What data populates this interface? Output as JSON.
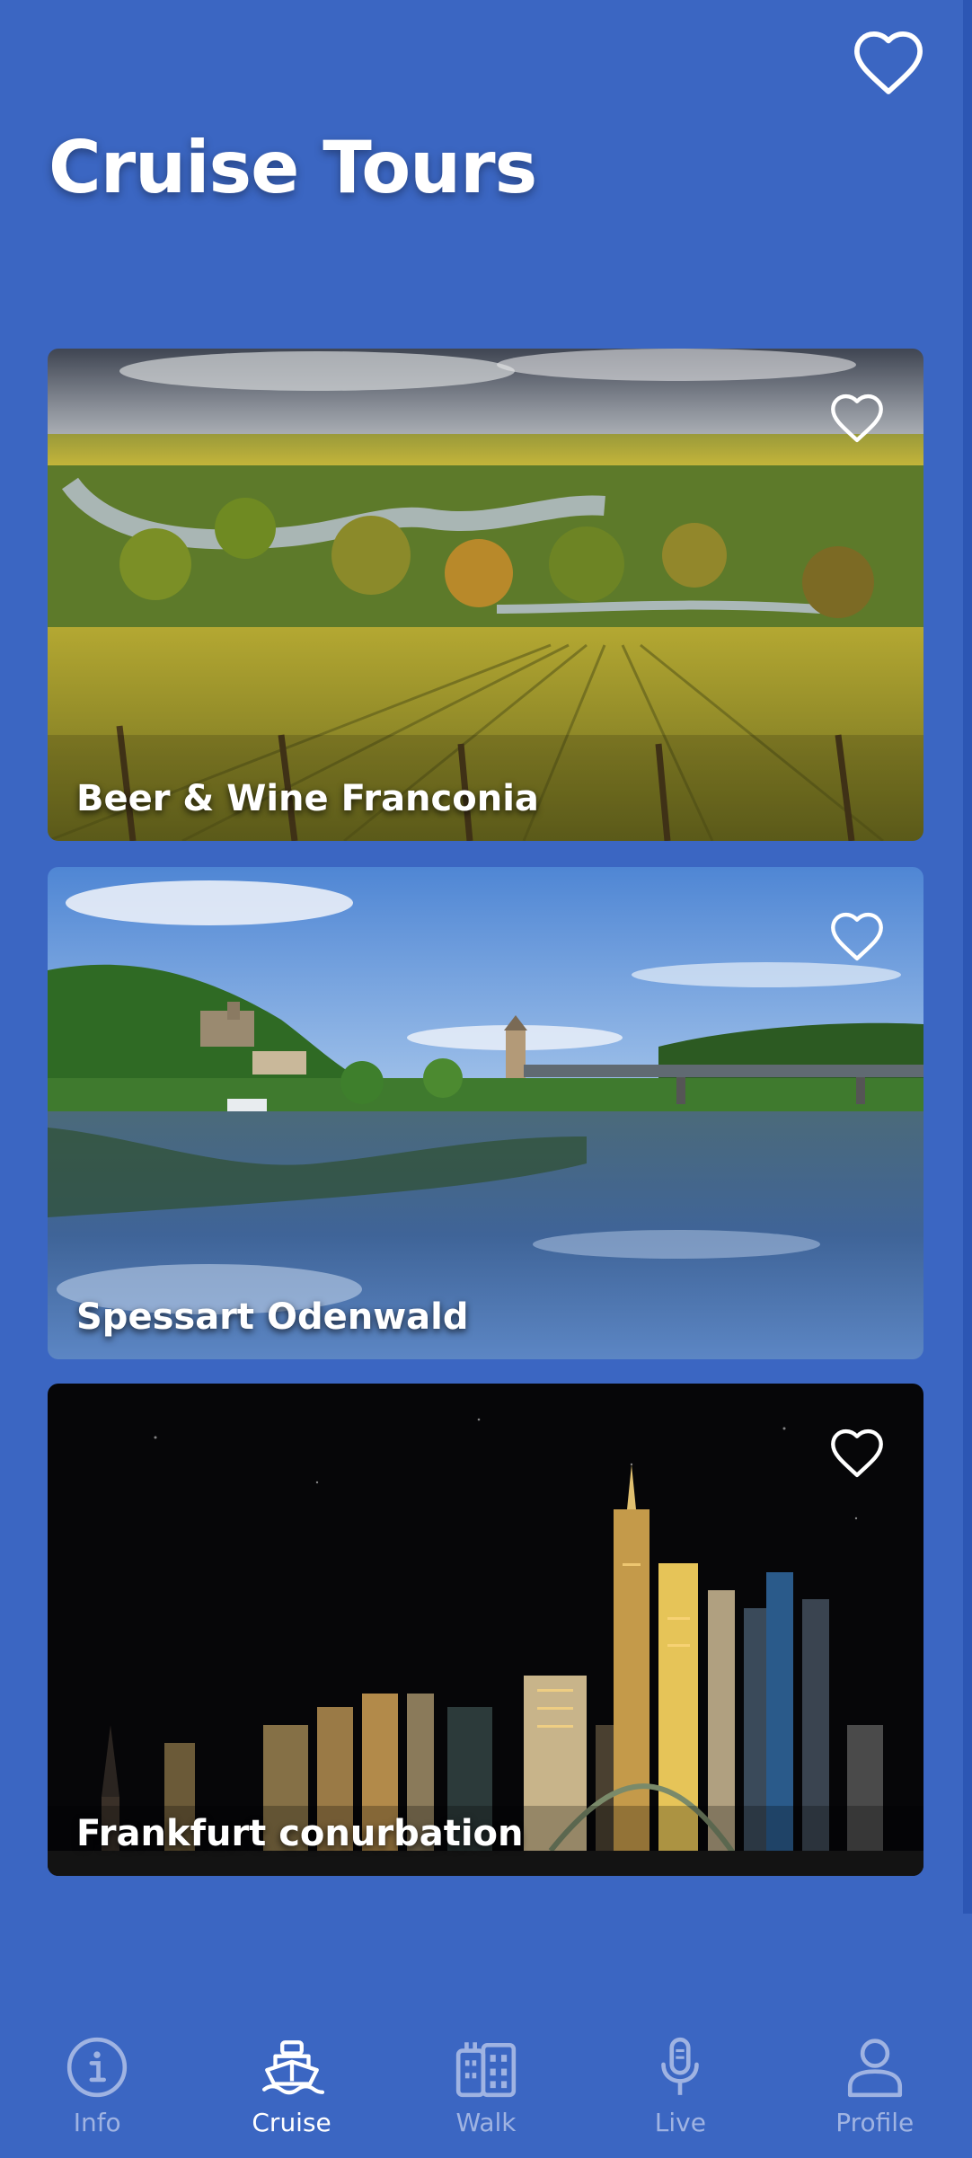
{
  "header": {
    "title": "Cruise Tours",
    "favorite_icon": "heart-outline-icon"
  },
  "tours": [
    {
      "title": "Beer & Wine Franconia",
      "favorite_icon": "heart-outline-icon"
    },
    {
      "title": "Spessart Odenwald",
      "favorite_icon": "heart-outline-icon"
    },
    {
      "title": "Frankfurt conurbation",
      "favorite_icon": "heart-outline-icon"
    }
  ],
  "bottom_nav": {
    "items": [
      {
        "label": "Info",
        "icon": "info-icon"
      },
      {
        "label": "Cruise",
        "icon": "ship-icon",
        "active": true
      },
      {
        "label": "Walk",
        "icon": "city-icon"
      },
      {
        "label": "Live",
        "icon": "microphone-icon"
      },
      {
        "label": "Profile",
        "icon": "profile-icon"
      }
    ]
  },
  "colors": {
    "background": "#3b66c2",
    "nav_inactive": "#9fb3e2",
    "nav_active": "#ffffff"
  }
}
